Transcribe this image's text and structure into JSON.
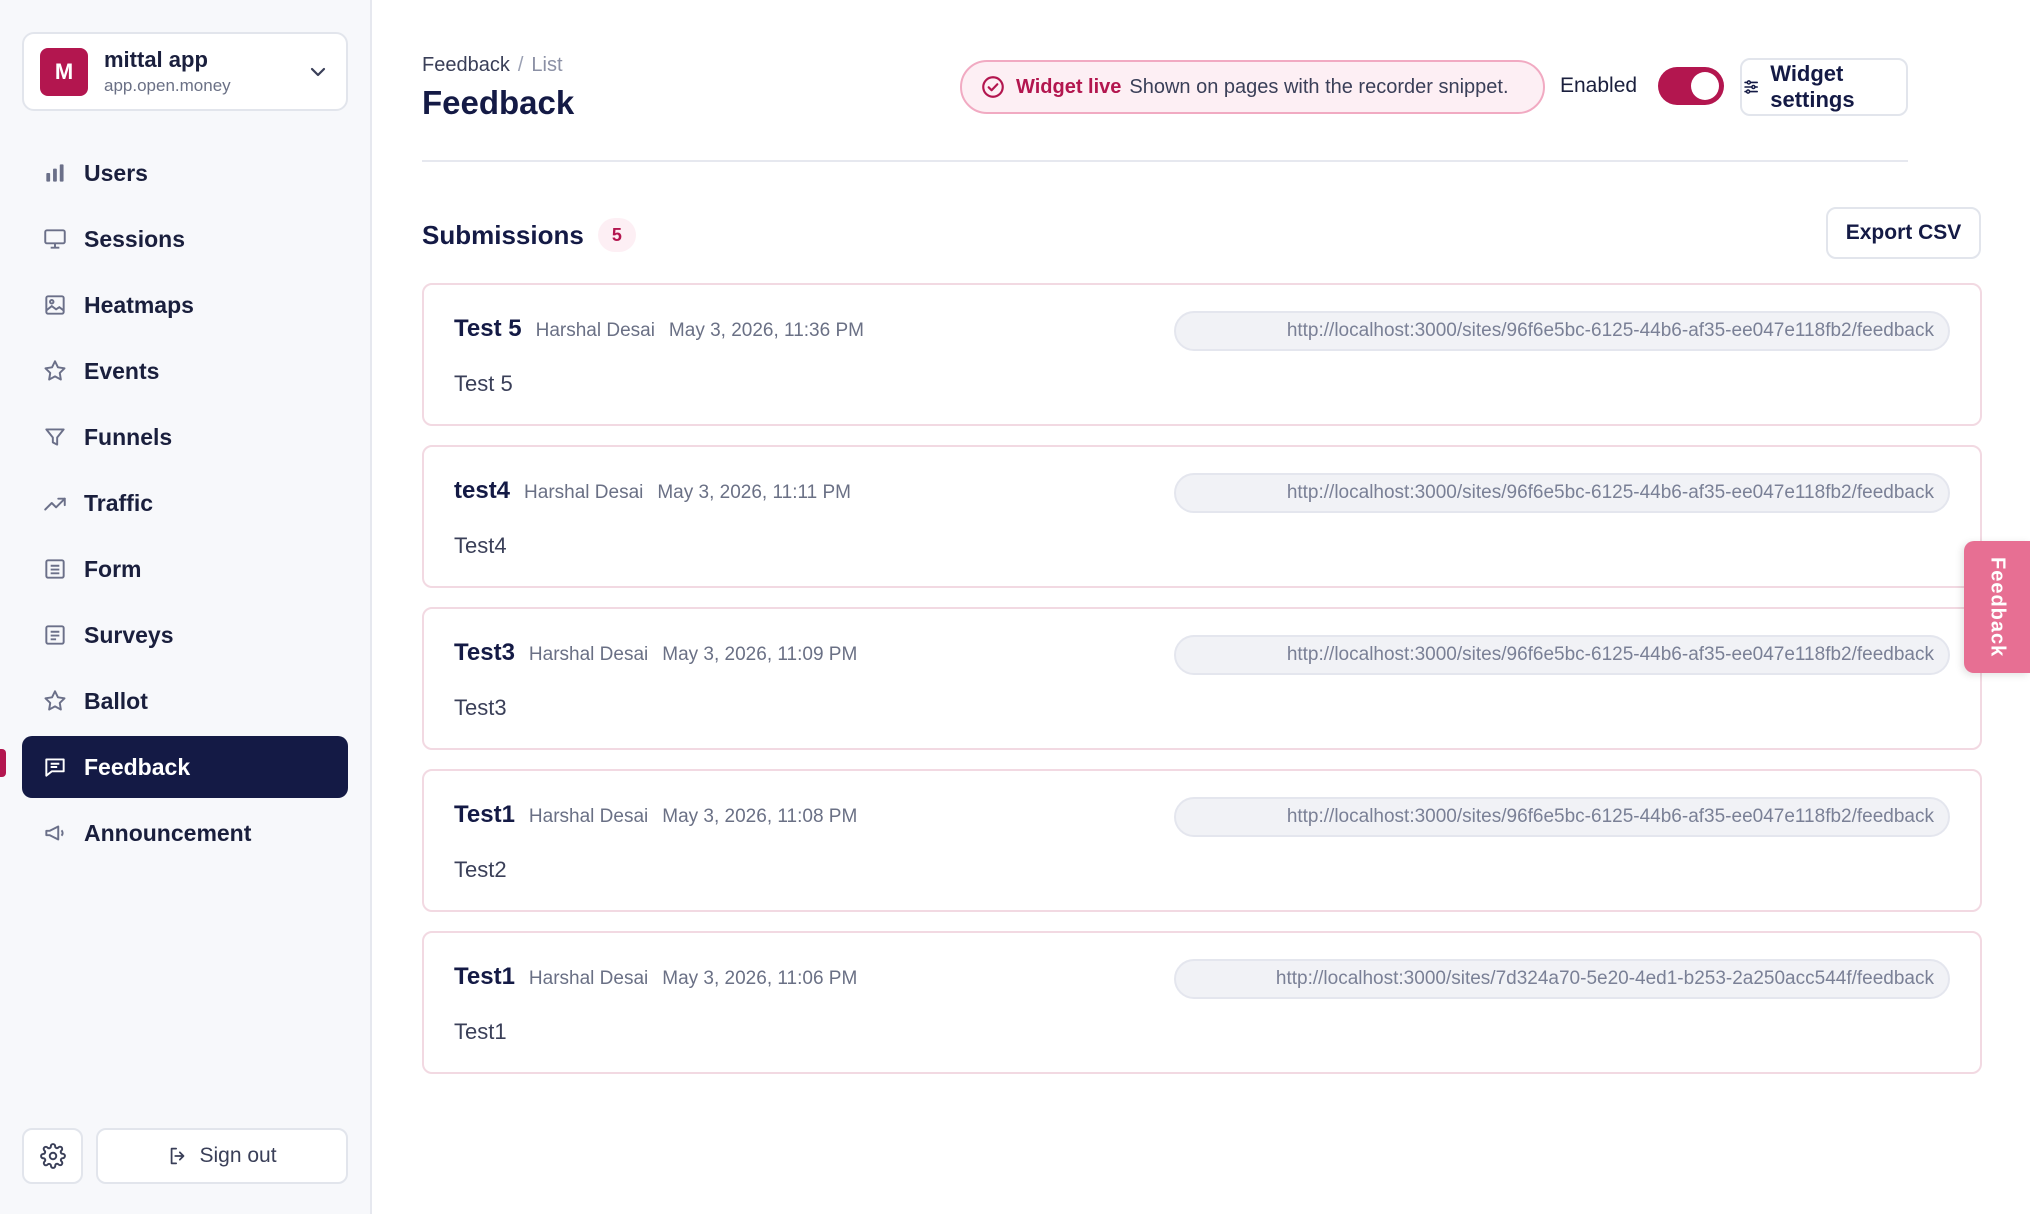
{
  "workspace": {
    "initial": "M",
    "name": "mittal app",
    "domain": "app.open.money"
  },
  "sidebar": {
    "items": [
      {
        "label": "Users",
        "icon": "bar-chart-icon",
        "active": false
      },
      {
        "label": "Sessions",
        "icon": "monitor-icon",
        "active": false
      },
      {
        "label": "Heatmaps",
        "icon": "image-icon",
        "active": false
      },
      {
        "label": "Events",
        "icon": "star-icon",
        "active": false
      },
      {
        "label": "Funnels",
        "icon": "funnel-icon",
        "active": false
      },
      {
        "label": "Traffic",
        "icon": "trending-up-icon",
        "active": false
      },
      {
        "label": "Form",
        "icon": "list-icon",
        "active": false
      },
      {
        "label": "Surveys",
        "icon": "document-icon",
        "active": false
      },
      {
        "label": "Ballot",
        "icon": "star-icon",
        "active": false
      },
      {
        "label": "Feedback",
        "icon": "message-icon",
        "active": true
      },
      {
        "label": "Announcement",
        "icon": "megaphone-icon",
        "active": false
      }
    ],
    "sign_out": "Sign out"
  },
  "header": {
    "breadcrumb": [
      "Feedback",
      "List"
    ],
    "title": "Feedback",
    "live_label": "Widget live",
    "live_desc": "Shown on pages with the recorder snippet.",
    "enabled_label": "Enabled",
    "enabled": true,
    "widget_settings": "Widget settings"
  },
  "submissions": {
    "title": "Submissions",
    "count": "5",
    "export_label": "Export CSV",
    "items": [
      {
        "title": "Test 5",
        "author": "Harshal Desai",
        "date": "May 3, 2026, 11:36 PM",
        "body": "Test 5",
        "url": "http://localhost:3000/sites/96f6e5bc-6125-44b6-af35-ee047e118fb2/feedback"
      },
      {
        "title": "test4",
        "author": "Harshal Desai",
        "date": "May 3, 2026, 11:11 PM",
        "body": "Test4",
        "url": "http://localhost:3000/sites/96f6e5bc-6125-44b6-af35-ee047e118fb2/feedback"
      },
      {
        "title": "Test3",
        "author": "Harshal Desai",
        "date": "May 3, 2026, 11:09 PM",
        "body": "Test3",
        "url": "http://localhost:3000/sites/96f6e5bc-6125-44b6-af35-ee047e118fb2/feedback"
      },
      {
        "title": "Test1",
        "author": "Harshal Desai",
        "date": "May 3, 2026, 11:08 PM",
        "body": "Test2",
        "url": "http://localhost:3000/sites/96f6e5bc-6125-44b6-af35-ee047e118fb2/feedback"
      },
      {
        "title": "Test1",
        "author": "Harshal Desai",
        "date": "May 3, 2026, 11:06 PM",
        "body": "Test1",
        "url": "http://localhost:3000/sites/7d324a70-5e20-4ed1-b253-2a250acc544f/feedback"
      }
    ]
  },
  "feedback_tab": "Feedback",
  "colors": {
    "accent": "#b3164f",
    "nav_active": "#141a45",
    "tab_pink": "#e76f93"
  }
}
